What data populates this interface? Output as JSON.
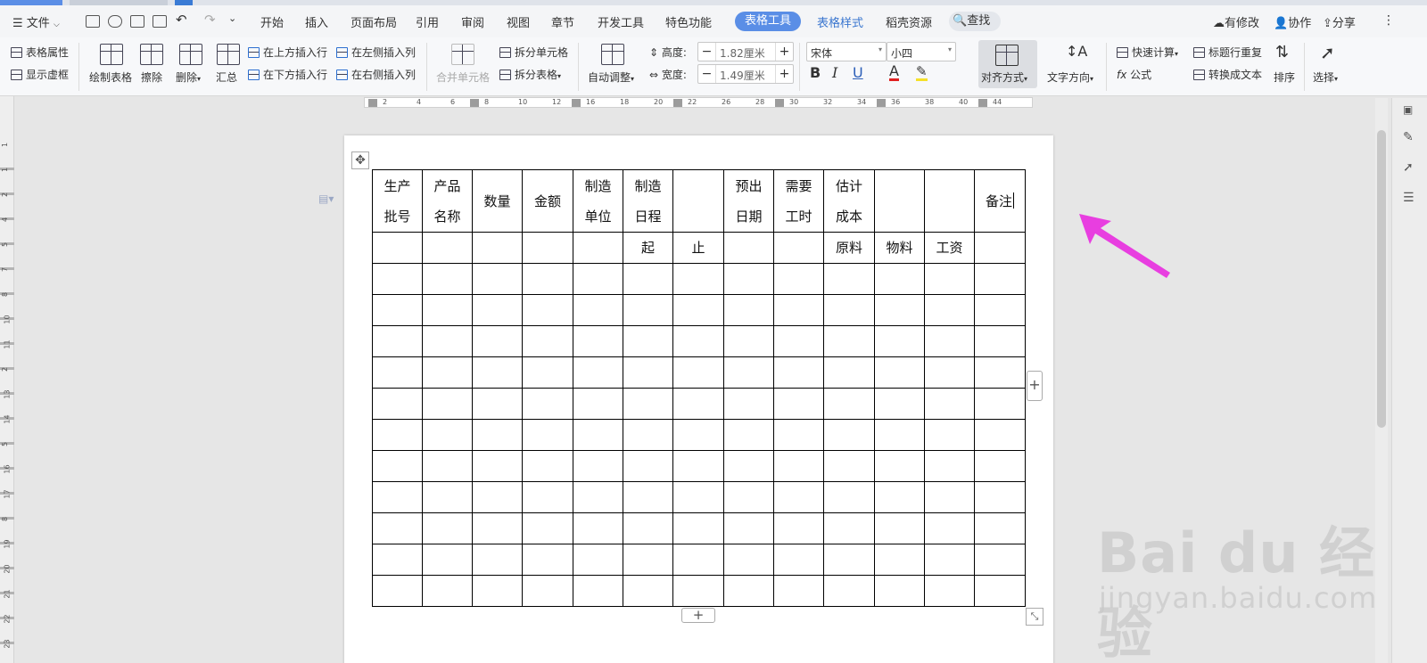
{
  "menu": {
    "file_label": "文件",
    "tabs": [
      "开始",
      "插入",
      "页面布局",
      "引用",
      "审阅",
      "视图",
      "章节",
      "开发工具",
      "特色功能"
    ],
    "active_tab": "表格工具",
    "table_style_tab": "表格样式",
    "resource_tab": "稻壳资源",
    "search_label": "查找",
    "right_actions": [
      "有修改",
      "协作",
      "分享"
    ]
  },
  "ribbon": {
    "table_props": "表格属性",
    "show_grid": "显示虚框",
    "draw_table": "绘制表格",
    "erase": "擦除",
    "delete": "删除",
    "summary": "汇总",
    "insert_row_above": "在上方插入行",
    "insert_row_below": "在下方插入行",
    "insert_col_left": "在左侧插入列",
    "insert_col_right": "在右侧插入列",
    "merge_cells": "合并单元格",
    "split_cells": "拆分单元格",
    "split_table": "拆分表格",
    "auto_adjust": "自动调整",
    "height_label": "高度:",
    "height_value": "1.82厘米",
    "width_label": "宽度:",
    "width_value": "1.49厘米",
    "font_name": "宋体",
    "font_size": "小四",
    "align": "对齐方式",
    "text_direction": "文字方向",
    "quick_calc": "快速计算",
    "formula": "公式",
    "repeat_header": "标题行重复",
    "to_text": "转换成文本",
    "sort": "排序",
    "select": "选择"
  },
  "ruler": {
    "h_numbers": [
      "2",
      "4",
      "6",
      "8",
      "10",
      "12",
      "16",
      "18",
      "20",
      "22",
      "26",
      "28",
      "30",
      "32",
      "34",
      "36",
      "38",
      "40",
      "44"
    ],
    "v_numbers": [
      "1",
      "1",
      "2",
      "4",
      "5",
      "7",
      "8",
      "10",
      "11",
      "2",
      "13",
      "14",
      "5",
      "16",
      "17",
      "8",
      "19",
      "20",
      "21",
      "22",
      "23",
      "24"
    ]
  },
  "table": {
    "header": [
      [
        "生产",
        "批号"
      ],
      [
        "产品",
        "名称"
      ],
      [
        "数量"
      ],
      [
        "金额"
      ],
      [
        "制造",
        "单位"
      ],
      [
        "制造",
        "日程"
      ],
      [
        ""
      ],
      [
        "预出",
        "日期"
      ],
      [
        "需要",
        "工时"
      ],
      [
        "估计",
        "成本"
      ],
      [
        ""
      ],
      [
        ""
      ],
      [
        "备注"
      ]
    ],
    "subheader": [
      "",
      "",
      "",
      "",
      "",
      "起",
      "止",
      "",
      "",
      "原料",
      "物料",
      "工资",
      ""
    ],
    "empty_rows": 11
  },
  "watermark": {
    "brand": "Bai du 经验",
    "url": "jingyan.baidu.com"
  },
  "colors": {
    "accent": "#5a8ee6",
    "arrow": "#e83ee0"
  }
}
